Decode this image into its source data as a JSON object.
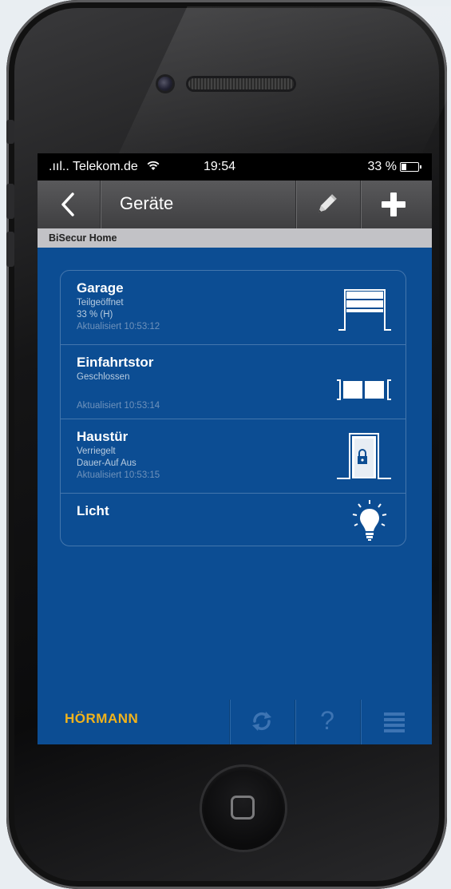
{
  "status_bar": {
    "carrier": ".ııl.. Telekom.de",
    "wifi_icon": "wifi-icon",
    "time": "19:54",
    "battery": "33 %"
  },
  "nav": {
    "back_icon": "chevron-left-icon",
    "title": "Geräte",
    "edit_icon": "pencil-icon",
    "add_icon": "plus-icon"
  },
  "section_header": "BiSecur Home",
  "devices": [
    {
      "name": "Garage",
      "lines": [
        "Teilgeöffnet",
        "33 % (H)"
      ],
      "updated": "Aktualisiert 10:53:12",
      "icon": "garage-door-icon"
    },
    {
      "name": "Einfahrtstor",
      "lines": [
        "Geschlossen"
      ],
      "updated": "Aktualisiert 10:53:14",
      "icon": "gate-icon"
    },
    {
      "name": "Haustür",
      "lines": [
        "Verriegelt",
        "Dauer-Auf Aus"
      ],
      "updated": "Aktualisiert 10:53:15",
      "icon": "locked-door-icon"
    },
    {
      "name": "Licht",
      "lines": [],
      "updated": "",
      "icon": "light-bulb-icon"
    }
  ],
  "tabbar": {
    "logo": "HÖRMANN",
    "refresh_icon": "refresh-icon",
    "help_label": "?",
    "menu_icon": "menu-icon"
  },
  "colors": {
    "screen_bg": "#0c4d93",
    "logo": "#f2b31b"
  }
}
